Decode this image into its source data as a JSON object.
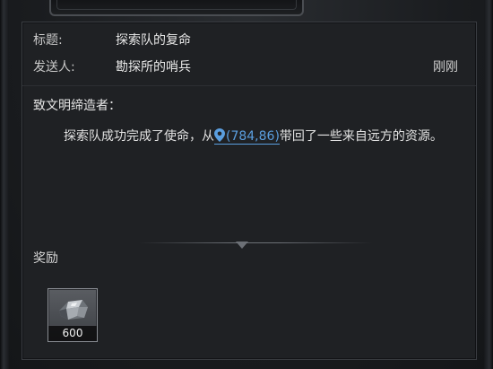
{
  "mail": {
    "title_label": "标题:",
    "title_value": "探索队的复命",
    "sender_label": "发送人:",
    "sender_value": "勘探所的哨兵",
    "time": "刚刚",
    "greeting": "致文明缔造者：",
    "body_before": "探索队成功完成了使命，从",
    "coordinate": "(784,86)",
    "body_after": "带回了一些来自远方的资源。"
  },
  "rewards": {
    "label": "奖励",
    "items": [
      {
        "icon": "iron-ore-icon",
        "quantity": "600"
      }
    ]
  },
  "colors": {
    "link": "#5b9fe0",
    "panel_bg": "#1f2124",
    "text": "#e2e2e2"
  }
}
